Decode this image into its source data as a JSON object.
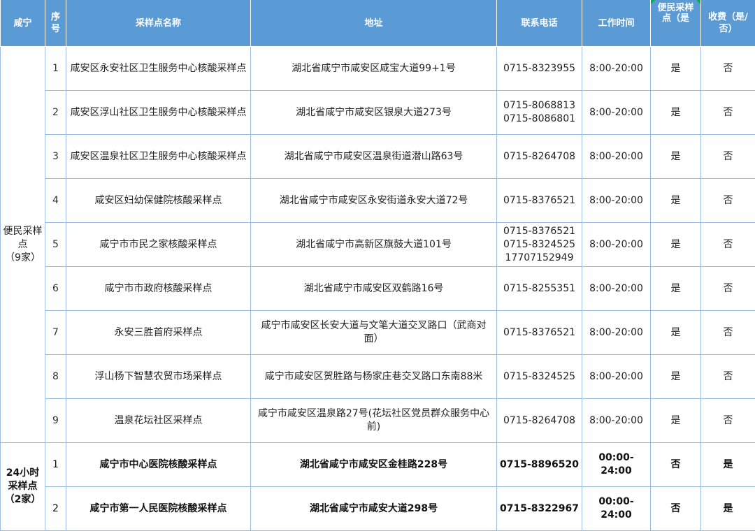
{
  "header": {
    "region": "咸宁",
    "seq": "序号",
    "name": "采样点名称",
    "address": "地址",
    "phone": "联系电话",
    "hours": "工作时间",
    "convenient": "便民采样点（是",
    "fee": "收费（是/否）"
  },
  "groups": [
    {
      "label_line1": "便民采样",
      "label_line2": "点",
      "label_line3": "（9家）",
      "rows": [
        {
          "seq": "1",
          "name": "咸安区永安社区卫生服务中心核酸采样点",
          "address": "湖北省咸宁市咸安区咸宝大道99+1号",
          "phones": [
            "0715-8323955"
          ],
          "hours": "8:00-20:00",
          "convenient": "是",
          "fee": "否"
        },
        {
          "seq": "2",
          "name": "咸安区浮山社区卫生服务中心核酸采样点",
          "address": "湖北省咸宁市咸安区银泉大道273号",
          "phones": [
            "0715-8068813",
            "0715-8086801"
          ],
          "hours": "8:00-20:00",
          "convenient": "是",
          "fee": "否"
        },
        {
          "seq": "3",
          "name": "咸安区温泉社区卫生服务中心核酸采样点",
          "address": "湖北省咸宁市咸安区温泉街道潜山路63号",
          "phones": [
            "0715-8264708"
          ],
          "hours": "8:00-20:00",
          "convenient": "是",
          "fee": "否"
        },
        {
          "seq": "4",
          "name": "咸安区妇幼保健院核酸采样点",
          "address": "湖北省咸宁市咸安区永安街道永安大道72号",
          "phones": [
            "0715-8376521"
          ],
          "hours": "8:00-20:00",
          "convenient": "是",
          "fee": "否"
        },
        {
          "seq": "5",
          "name": "咸宁市市民之家核酸采样点",
          "address": "湖北省咸宁市高新区旗鼓大道101号",
          "phones": [
            "0715-8376521",
            "0715-8324525",
            "17707152949"
          ],
          "hours": "8:00-20:00",
          "convenient": "是",
          "fee": "否"
        },
        {
          "seq": "6",
          "name": "咸宁市市政府核酸采样点",
          "address": "湖北省咸宁市咸安区双鹤路16号",
          "phones": [
            "0715-8255351"
          ],
          "hours": "8:00-20:00",
          "convenient": "是",
          "fee": "否"
        },
        {
          "seq": "7",
          "name": "永安三胜首府采样点",
          "address": "咸宁市咸安区长安大道与文笔大道交叉路口（武商对面）",
          "phones": [
            "0715-8376521"
          ],
          "hours": "8:00-20:00",
          "convenient": "是",
          "fee": "否"
        },
        {
          "seq": "8",
          "name": "浮山杨下智慧农贸市场采样点",
          "address": "咸宁市咸安区贺胜路与杨家庄巷交叉路口东南88米",
          "phones": [
            "0715-8324525"
          ],
          "hours": "8:00-20:00",
          "convenient": "是",
          "fee": "否"
        },
        {
          "seq": "9",
          "name": "温泉花坛社区采样点",
          "address": "咸宁市咸安区温泉路27号(花坛社区党员群众服务中心前)",
          "phones": [
            "0715-8264708"
          ],
          "hours": "8:00-20:00",
          "convenient": "是",
          "fee": "否"
        }
      ]
    },
    {
      "label_line1": "24小时",
      "label_line2": "采样点",
      "label_line3": "（2家）",
      "rows": [
        {
          "seq": "1",
          "name": "咸宁市中心医院核酸采样点",
          "address": "湖北省咸宁市咸安区金桂路228号",
          "phones": [
            "0715-8896520"
          ],
          "hours": "00:00-24:00",
          "convenient": "否",
          "fee": "是"
        },
        {
          "seq": "2",
          "name": "咸宁市第一人民医院核酸采样点",
          "address": "湖北省咸宁市咸安大道298号",
          "phones": [
            "0715-8322967"
          ],
          "hours": "00:00-24:00",
          "convenient": "否",
          "fee": "是"
        }
      ]
    }
  ]
}
